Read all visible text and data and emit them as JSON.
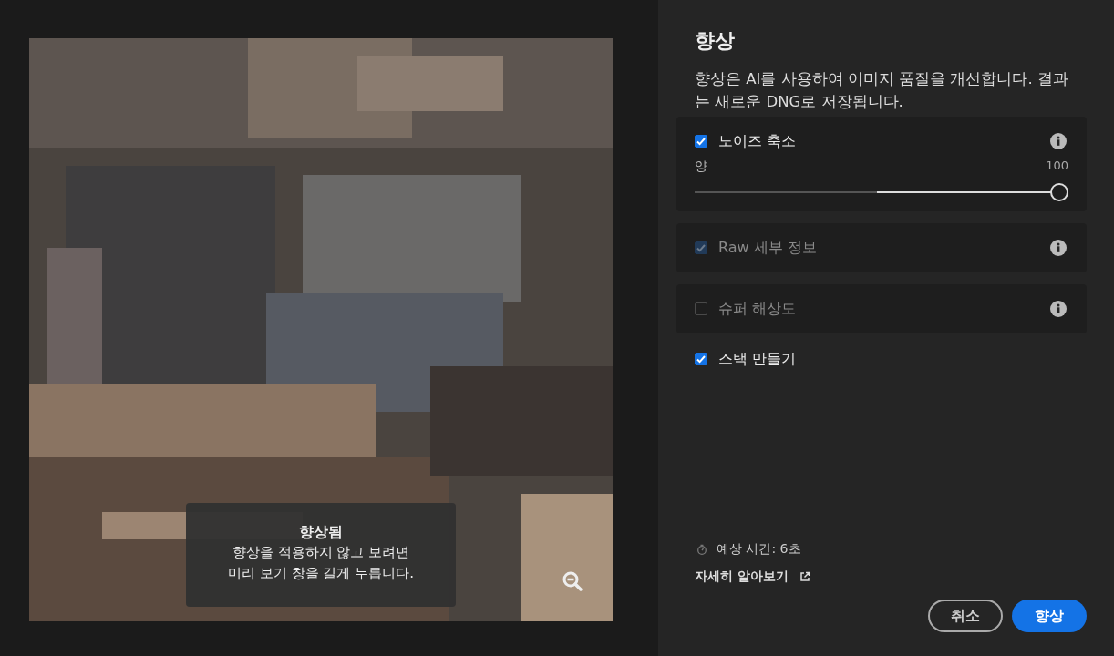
{
  "preview": {
    "overlay": {
      "title": "향상됨",
      "lines": [
        "향상을 적용하지 않고 보려면",
        "미리 보기 창을 길게 누릅니다."
      ]
    }
  },
  "panel": {
    "title": "향상",
    "description": "향상은 AI를 사용하여 이미지 품질을 개선합니다. 결과는 새로운 DNG로 저장됩니다.",
    "options": [
      {
        "label": "노이즈 축소",
        "checked": true,
        "disabled": false,
        "boxed": true,
        "info": true,
        "slider": {
          "label": "양",
          "value": "100",
          "level": 1
        }
      },
      {
        "label": "Raw 세부 정보",
        "checked": true,
        "disabled": true,
        "boxed": true,
        "info": true
      },
      {
        "label": "슈퍼 해상도",
        "checked": false,
        "disabled": true,
        "boxed": true,
        "info": true
      },
      {
        "label": "스택 만들기",
        "checked": true,
        "disabled": false,
        "boxed": false,
        "info": false
      }
    ],
    "estimate": "예상 시간: 6초",
    "learn_more": "자세히 알아보기",
    "buttons": [
      {
        "label": "취소",
        "kind": "secondary"
      },
      {
        "label": "향상",
        "kind": "primary"
      }
    ]
  }
}
